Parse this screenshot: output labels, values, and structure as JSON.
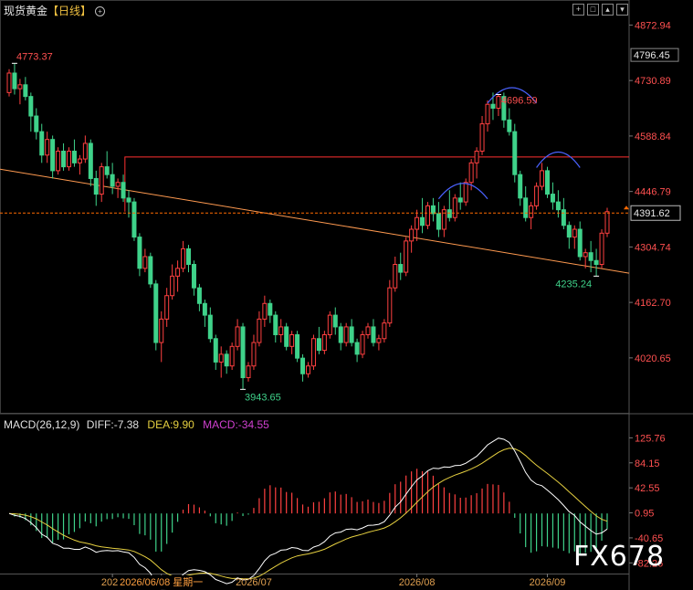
{
  "header": {
    "symbol": "现货黄金",
    "timeframe": "【日线】",
    "settings_icon": "circle-plus-icon",
    "window_controls": [
      "crosshair-icon",
      "fullscreen-icon",
      "expand-icon",
      "collapse-icon"
    ]
  },
  "colors": {
    "up": "#ff4040",
    "down": "#3fd28a",
    "trend": "#ff9a50",
    "resistance": "#ff3030",
    "current": "#ff6a00",
    "arc": "#4a62ff",
    "diff_line": "#ffffff",
    "dea_line": "#e6d040",
    "axis_text": "#ff5050",
    "axis_green": "#3fd28a"
  },
  "chart_data": {
    "type": "candlestick",
    "title": "现货黄金【日线】",
    "price_axis": {
      "ticks": [
        4872.94,
        4730.89,
        4588.84,
        4446.79,
        4304.74,
        4162.7,
        4020.65
      ],
      "ylim": [
        3880,
        4895
      ]
    },
    "current_price": 4391.62,
    "marked_price": 4796.45,
    "annotations": [
      {
        "label": "4773.37",
        "type": "high",
        "index": 1
      },
      {
        "label": "3943.65",
        "type": "low",
        "index": 43
      },
      {
        "label": "4696.59",
        "type": "high",
        "index": 90
      },
      {
        "label": "4235.24",
        "type": "low",
        "index": 108
      }
    ],
    "date_axis": [
      "2026",
      "2026/06/08 星期一",
      "2026/07",
      "2026/08",
      "2026/09"
    ],
    "date_axis_index": [
      19,
      28,
      45,
      75,
      99
    ],
    "candles": [
      [
        4700,
        4760,
        4690,
        4750
      ],
      [
        4750,
        4775,
        4695,
        4710
      ],
      [
        4710,
        4735,
        4670,
        4720
      ],
      [
        4720,
        4740,
        4680,
        4690
      ],
      [
        4690,
        4700,
        4600,
        4640
      ],
      [
        4640,
        4660,
        4580,
        4600
      ],
      [
        4600,
        4620,
        4520,
        4540
      ],
      [
        4540,
        4600,
        4520,
        4580
      ],
      [
        4580,
        4590,
        4480,
        4500
      ],
      [
        4500,
        4560,
        4490,
        4550
      ],
      [
        4550,
        4570,
        4500,
        4510
      ],
      [
        4510,
        4560,
        4500,
        4550
      ],
      [
        4550,
        4580,
        4510,
        4520
      ],
      [
        4520,
        4540,
        4490,
        4530
      ],
      [
        4530,
        4590,
        4520,
        4570
      ],
      [
        4570,
        4580,
        4460,
        4480
      ],
      [
        4480,
        4500,
        4410,
        4440
      ],
      [
        4440,
        4520,
        4420,
        4510
      ],
      [
        4510,
        4550,
        4480,
        4490
      ],
      [
        4490,
        4520,
        4440,
        4460
      ],
      [
        4460,
        4480,
        4430,
        4470
      ],
      [
        4470,
        4490,
        4420,
        4430
      ],
      [
        4430,
        4450,
        4380,
        4420
      ],
      [
        4420,
        4430,
        4320,
        4330
      ],
      [
        4330,
        4340,
        4230,
        4250
      ],
      [
        4250,
        4300,
        4240,
        4280
      ],
      [
        4280,
        4290,
        4200,
        4210
      ],
      [
        4210,
        4220,
        4040,
        4060
      ],
      [
        4060,
        4140,
        4010,
        4120
      ],
      [
        4120,
        4200,
        4100,
        4180
      ],
      [
        4180,
        4260,
        4170,
        4230
      ],
      [
        4230,
        4270,
        4190,
        4250
      ],
      [
        4250,
        4320,
        4240,
        4300
      ],
      [
        4300,
        4310,
        4240,
        4260
      ],
      [
        4260,
        4270,
        4180,
        4200
      ],
      [
        4200,
        4210,
        4140,
        4160
      ],
      [
        4160,
        4170,
        4100,
        4130
      ],
      [
        4130,
        4150,
        4060,
        4070
      ],
      [
        4070,
        4080,
        3990,
        4010
      ],
      [
        4010,
        4050,
        3970,
        4030
      ],
      [
        4030,
        4040,
        3980,
        4000
      ],
      [
        4000,
        4060,
        3990,
        4050
      ],
      [
        4050,
        4120,
        4040,
        4100
      ],
      [
        4100,
        4110,
        3940,
        3970
      ],
      [
        3970,
        4010,
        3960,
        4000
      ],
      [
        4000,
        4080,
        3990,
        4060
      ],
      [
        4060,
        4140,
        4050,
        4120
      ],
      [
        4120,
        4180,
        4100,
        4160
      ],
      [
        4160,
        4170,
        4110,
        4130
      ],
      [
        4130,
        4140,
        4060,
        4080
      ],
      [
        4080,
        4120,
        4060,
        4100
      ],
      [
        4100,
        4110,
        4040,
        4050
      ],
      [
        4050,
        4090,
        4030,
        4080
      ],
      [
        4080,
        4090,
        4010,
        4020
      ],
      [
        4020,
        4030,
        3960,
        3980
      ],
      [
        3980,
        4010,
        3970,
        4000
      ],
      [
        4000,
        4080,
        3990,
        4070
      ],
      [
        4070,
        4100,
        4030,
        4040
      ],
      [
        4040,
        4090,
        4030,
        4080
      ],
      [
        4080,
        4140,
        4070,
        4130
      ],
      [
        4130,
        4150,
        4080,
        4100
      ],
      [
        4100,
        4110,
        4040,
        4060
      ],
      [
        4060,
        4110,
        4050,
        4100
      ],
      [
        4100,
        4120,
        4050,
        4060
      ],
      [
        4060,
        4070,
        4010,
        4030
      ],
      [
        4030,
        4090,
        4020,
        4080
      ],
      [
        4080,
        4110,
        4070,
        4100
      ],
      [
        4100,
        4120,
        4050,
        4060
      ],
      [
        4060,
        4080,
        4040,
        4070
      ],
      [
        4070,
        4120,
        4060,
        4110
      ],
      [
        4110,
        4220,
        4100,
        4200
      ],
      [
        4200,
        4280,
        4190,
        4260
      ],
      [
        4260,
        4290,
        4220,
        4240
      ],
      [
        4240,
        4330,
        4230,
        4320
      ],
      [
        4320,
        4360,
        4290,
        4350
      ],
      [
        4350,
        4400,
        4320,
        4380
      ],
      [
        4380,
        4430,
        4340,
        4360
      ],
      [
        4360,
        4420,
        4350,
        4410
      ],
      [
        4410,
        4430,
        4370,
        4390
      ],
      [
        4390,
        4420,
        4330,
        4350
      ],
      [
        4350,
        4410,
        4330,
        4400
      ],
      [
        4400,
        4450,
        4370,
        4380
      ],
      [
        4380,
        4440,
        4370,
        4430
      ],
      [
        4430,
        4470,
        4400,
        4420
      ],
      [
        4420,
        4480,
        4410,
        4470
      ],
      [
        4470,
        4530,
        4450,
        4520
      ],
      [
        4520,
        4560,
        4480,
        4550
      ],
      [
        4550,
        4640,
        4540,
        4620
      ],
      [
        4620,
        4680,
        4600,
        4670
      ],
      [
        4670,
        4700,
        4630,
        4660
      ],
      [
        4660,
        4695,
        4640,
        4690
      ],
      [
        4690,
        4700,
        4610,
        4630
      ],
      [
        4630,
        4660,
        4590,
        4600
      ],
      [
        4600,
        4620,
        4470,
        4490
      ],
      [
        4490,
        4500,
        4410,
        4430
      ],
      [
        4430,
        4460,
        4370,
        4380
      ],
      [
        4380,
        4420,
        4350,
        4410
      ],
      [
        4410,
        4470,
        4400,
        4460
      ],
      [
        4460,
        4520,
        4450,
        4500
      ],
      [
        4500,
        4510,
        4430,
        4440
      ],
      [
        4440,
        4470,
        4400,
        4420
      ],
      [
        4420,
        4450,
        4380,
        4400
      ],
      [
        4400,
        4430,
        4350,
        4360
      ],
      [
        4360,
        4370,
        4300,
        4330
      ],
      [
        4330,
        4360,
        4300,
        4350
      ],
      [
        4350,
        4370,
        4270,
        4280
      ],
      [
        4280,
        4300,
        4250,
        4290
      ],
      [
        4290,
        4320,
        4240,
        4270
      ],
      [
        4270,
        4300,
        4230,
        4260
      ],
      [
        4260,
        4350,
        4250,
        4340
      ],
      [
        4340,
        4405,
        4330,
        4395
      ]
    ],
    "macd": {
      "params": "MACD(26,12,9)",
      "diff": -7.38,
      "dea": 9.9,
      "macd": -34.55,
      "axis_ticks": [
        125.76,
        84.15,
        42.55,
        0.95,
        -40.65,
        -82.26
      ],
      "ylim": [
        -100,
        140
      ]
    }
  },
  "texts": {
    "macd_name": "MACD(26,12,9)",
    "diff_text": "DIFF:-7.38",
    "dea_text": "DEA:9.90",
    "macd_text": "MACD:-34.55",
    "watermark": "FX678"
  }
}
